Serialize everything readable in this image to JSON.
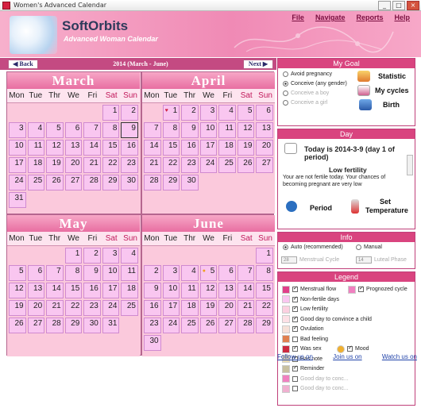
{
  "window": {
    "title": "Women's Advanced Calendar"
  },
  "brand": {
    "name": "SoftOrbits",
    "subtitle": "Advanced Woman Calendar"
  },
  "menu": [
    "File",
    "Navigate",
    "Reports",
    "Help"
  ],
  "nav": {
    "back": "Back",
    "next": "Next",
    "range": "2014 (March - June)"
  },
  "dow": [
    "Mon",
    "Tue",
    "Thr",
    "We",
    "Fri",
    "Sat",
    "Sun"
  ],
  "months": [
    {
      "name": "March",
      "offset": 5,
      "days": 31,
      "today": 9,
      "marks": {}
    },
    {
      "name": "April",
      "offset": 1,
      "days": 30,
      "marks": {
        "1": "heart"
      }
    },
    {
      "name": "May",
      "offset": 3,
      "days": 31,
      "marks": {}
    },
    {
      "name": "June",
      "offset": 6,
      "days": 30,
      "marks": {
        "5": "smile"
      }
    }
  ],
  "goal": {
    "title": "My Goal",
    "options": [
      {
        "label": "Avoid pregnancy",
        "selected": false,
        "enabled": true
      },
      {
        "label": "Conceive (any gender)",
        "selected": true,
        "enabled": true
      },
      {
        "label": "Conceive a boy",
        "selected": false,
        "enabled": false
      },
      {
        "label": "Conceive a girl",
        "selected": false,
        "enabled": false
      }
    ],
    "actions": [
      "Statistic",
      "My cycles",
      "Birth"
    ]
  },
  "day": {
    "title": "Day",
    "today": "Today is 2014-3-9 (day 1 of period)",
    "fertility": "Low fertility",
    "fertility_text": "Your are not fertile today. Your chances of becoming pregnant are very low",
    "period": "Period",
    "set_temperature_1": "Set",
    "set_temperature_2": "Temperature"
  },
  "info": {
    "title": "Info",
    "auto": "Auto (recommended)",
    "manual": "Manual",
    "menstrual_value": "28",
    "menstrual_label": "Menstrual Cycle",
    "luteal_value": "14",
    "luteal_label": "Luteal Phase"
  },
  "legend": {
    "title": "Legend",
    "items": [
      {
        "label": "Menstrual flow",
        "color": "#e0408a",
        "checked": true
      },
      {
        "label": "Non-fertile days",
        "color": "#f9c6f0",
        "checked": true
      },
      {
        "label": "Low fertility",
        "color": "#fbd0e0",
        "checked": true
      },
      {
        "label": "Good day to convince a child",
        "color": "#fde0e6",
        "checked": true
      },
      {
        "label": "Ovulation",
        "color": "#f6e0d8",
        "checked": true
      },
      {
        "label": "Bad feeling",
        "color": "#e08050",
        "checked": false
      },
      {
        "label": "Was sex",
        "color": "#cc2a40",
        "checked": true
      },
      {
        "label": "Has note",
        "color": "#e8d8b0",
        "checked": true
      },
      {
        "label": "Reminder",
        "color": "#c8c0a0",
        "checked": true
      },
      {
        "label": "Good day to conc...",
        "color": "#f080c0",
        "checked": false,
        "disabled": true
      },
      {
        "label": "Good day to conc...",
        "color": "#f0b0d0",
        "checked": false,
        "disabled": true
      }
    ],
    "prognozed": "Prognozed cycle",
    "mood": "Mood"
  },
  "footer": {
    "facebook": "Follow us on",
    "join": "Join us on",
    "watch": "Watch us on"
  },
  "colors": {
    "accent": "#d9447f",
    "banner": "#f08ab5",
    "day": "#f9c6f0"
  }
}
